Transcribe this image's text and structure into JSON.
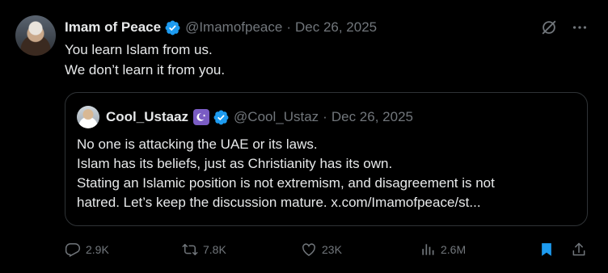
{
  "post": {
    "author_name": "Imam of Peace",
    "handle": "@Imamofpeace",
    "separator": "·",
    "date": "Dec 26, 2025",
    "text_lines": [
      "You learn Islam from us.",
      "We don’t learn it from you."
    ]
  },
  "quoted_post": {
    "author_name": "Cool_Ustaaz",
    "handle": "@Cool_Ustaz",
    "separator": "·",
    "date": "Dec 26, 2025",
    "text_lines": [
      "No one is attacking the UAE or its laws.",
      "Islam has its beliefs, just as Christianity has its own.",
      "Stating an Islamic position is not extremism, and disagreement is not",
      "hatred. Let’s keep the discussion mature. x.com/Imamofpeace/st..."
    ]
  },
  "metrics": {
    "replies": "2.9K",
    "reposts": "7.8K",
    "likes": "23K",
    "views": "2.6M"
  },
  "colors": {
    "background": "#000000",
    "text_primary": "#e7e9ea",
    "text_secondary": "#71767b",
    "verified_blue": "#1d9bf0",
    "bookmark_blue": "#1d9bf0",
    "border": "#2f3336",
    "badge_purple": "#7a5cc4"
  },
  "icons": {
    "verified": "verified-badge-icon",
    "grok": "grok-icon",
    "more": "more-icon",
    "reply": "reply-icon",
    "repost": "repost-icon",
    "like": "heart-icon",
    "views": "views-icon",
    "bookmark": "bookmark-icon",
    "share": "share-icon"
  }
}
